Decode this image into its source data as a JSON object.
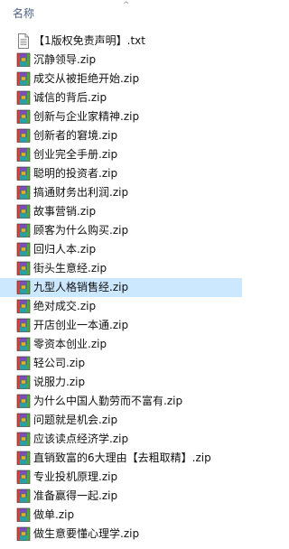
{
  "header": {
    "column_label": "名称",
    "sort_indicator": "^"
  },
  "files": [
    {
      "name": "【1版权免责声明】.txt",
      "type": "txt"
    },
    {
      "name": "沉静领导.zip",
      "type": "zip"
    },
    {
      "name": "成交从被拒绝开始.zip",
      "type": "zip"
    },
    {
      "name": "诚信的背后.zip",
      "type": "zip"
    },
    {
      "name": "创新与企业家精神.zip",
      "type": "zip"
    },
    {
      "name": "创新者的窘境.zip",
      "type": "zip"
    },
    {
      "name": "创业完全手册.zip",
      "type": "zip"
    },
    {
      "name": "聪明的投资者.zip",
      "type": "zip"
    },
    {
      "name": "搞通财务出利润.zip",
      "type": "zip"
    },
    {
      "name": "故事营销.zip",
      "type": "zip"
    },
    {
      "name": "顾客为什么购买.zip",
      "type": "zip"
    },
    {
      "name": "回归人本.zip",
      "type": "zip"
    },
    {
      "name": "街头生意经.zip",
      "type": "zip"
    },
    {
      "name": "九型人格销售经.zip",
      "type": "zip",
      "selected": true
    },
    {
      "name": "绝对成交.zip",
      "type": "zip"
    },
    {
      "name": "开店创业一本通.zip",
      "type": "zip"
    },
    {
      "name": "零资本创业.zip",
      "type": "zip"
    },
    {
      "name": "轻公司.zip",
      "type": "zip"
    },
    {
      "name": "说服力.zip",
      "type": "zip"
    },
    {
      "name": "为什么中国人勤劳而不富有.zip",
      "type": "zip"
    },
    {
      "name": "问题就是机会.zip",
      "type": "zip"
    },
    {
      "name": "应该读点经济学.zip",
      "type": "zip"
    },
    {
      "name": "直销致富的6大理由【去粗取精】.zip",
      "type": "zip"
    },
    {
      "name": "专业投机原理.zip",
      "type": "zip"
    },
    {
      "name": "准备赢得一起.zip",
      "type": "zip"
    },
    {
      "name": "做单.zip",
      "type": "zip"
    },
    {
      "name": "做生意要懂心理学.zip",
      "type": "zip"
    }
  ],
  "colors": {
    "header_text": "#4d6082",
    "selection": "#cce8ff",
    "zip_blue": "#2f6fc9",
    "zip_teal": "#2aa0a6",
    "zip_purple": "#7b4fb5",
    "zip_red": "#d9413b",
    "zip_green": "#4caa3c",
    "zip_gold": "#e0b52b"
  },
  "icons": {
    "txt": "text-document-icon",
    "zip": "winrar-archive-icon"
  }
}
